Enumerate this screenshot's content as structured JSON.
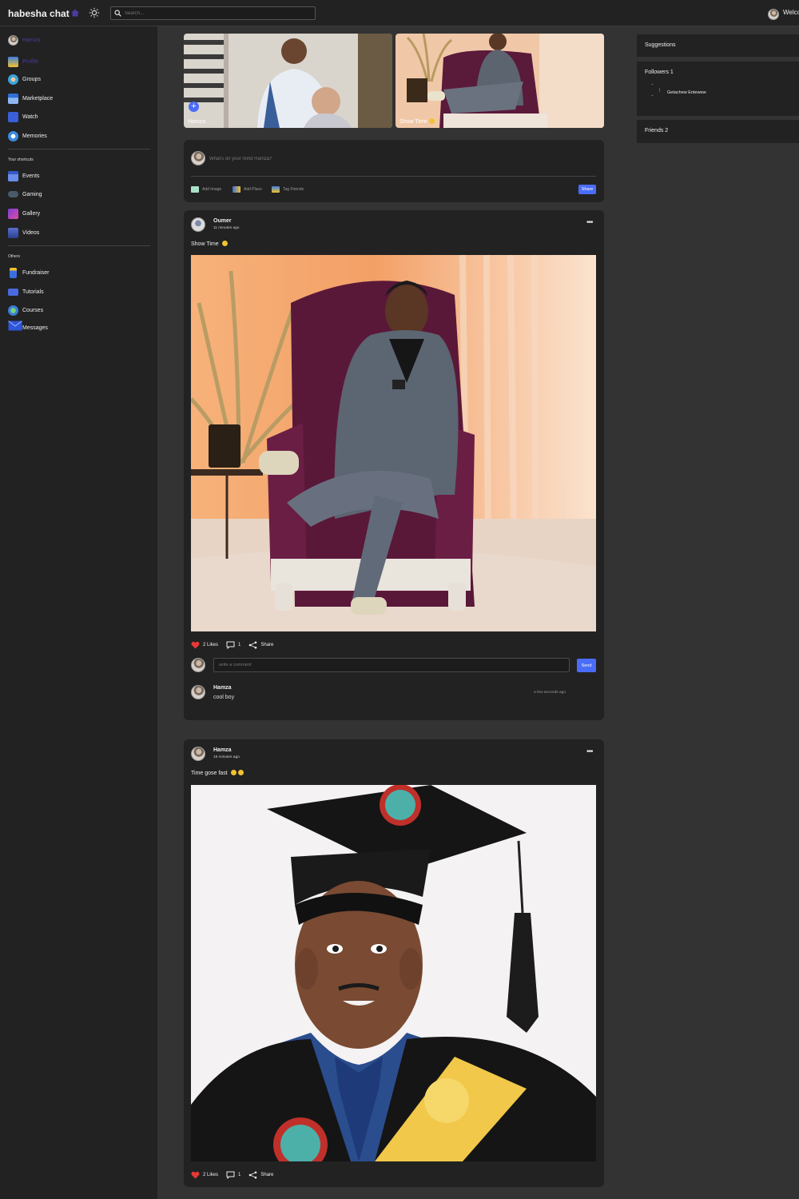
{
  "navbar": {
    "logo": "habesha chat",
    "search_placeholder": "Search...",
    "welcome": "Welcome",
    "icons": [
      "home-icon",
      "sun-icon",
      "search-icon"
    ]
  },
  "leftbar": {
    "top_items": [
      {
        "label": "Hamza",
        "icon": "avatar"
      },
      {
        "label": "Profile",
        "icon": "profile-icon"
      },
      {
        "label": "Groups",
        "icon": "groups-icon"
      },
      {
        "label": "Marketplace",
        "icon": "marketplace-icon"
      },
      {
        "label": "Watch",
        "icon": "watch-icon"
      },
      {
        "label": "Memories",
        "icon": "memories-icon"
      }
    ],
    "shortcuts_title": "Your shortcuts",
    "shortcut_items": [
      {
        "label": "Events",
        "icon": "events-icon"
      },
      {
        "label": "Gaming",
        "icon": "gaming-icon"
      },
      {
        "label": "Gallery",
        "icon": "gallery-icon"
      },
      {
        "label": "Videos",
        "icon": "videos-icon"
      }
    ],
    "others_title": "Others",
    "other_items": [
      {
        "label": "Fundraiser",
        "icon": "fundraiser-icon"
      },
      {
        "label": "Tutorials",
        "icon": "tutorials-icon"
      },
      {
        "label": "Courses",
        "icon": "courses-icon"
      },
      {
        "label": "Messages",
        "icon": "messages-icon"
      }
    ],
    "colors": {
      "active_label": "#4b3aa0"
    }
  },
  "rightbar": {
    "suggestions_title": "Suggestions",
    "followers_title": "Followers 1",
    "follower_name": "Getachew Entewew",
    "friends_title": "Friends 2"
  },
  "stories": [
    {
      "label": "Hamza"
    },
    {
      "label": "Show Time"
    }
  ],
  "composer": {
    "placeholder": "What's on your mind Hamza?",
    "add_image": "Add Image",
    "add_place": "Add Place",
    "tag_friends": "Tag Friends",
    "share": "Share"
  },
  "posts": [
    {
      "author": "Oumer",
      "time": "11 minutes ago",
      "text": "Show Time",
      "likes": "2 Likes",
      "comments": "1",
      "share": "Share",
      "comment_placeholder": "write a comment",
      "send": "Send",
      "comment": {
        "author": "Hamza",
        "text": "cool boy",
        "time": "a few seconds ago"
      }
    },
    {
      "author": "Hamza",
      "time": "19 minutes ago",
      "text": "Time gose fast",
      "likes": "2 Likes",
      "comments": "1",
      "share": "Share"
    }
  ],
  "colors": {
    "accent": "#4a6cf7",
    "like": "#e53935",
    "bg": "#333333",
    "panel": "#222222"
  }
}
